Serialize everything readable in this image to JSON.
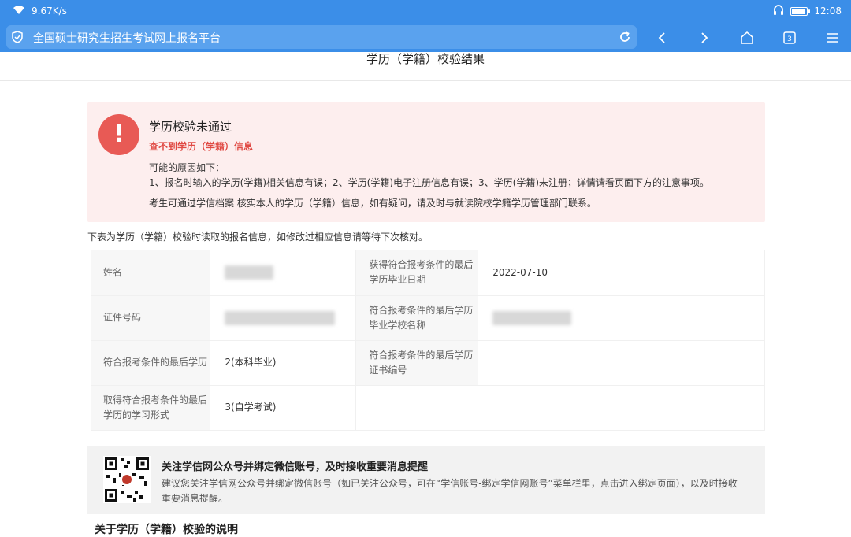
{
  "status_bar": {
    "speed": "9.67K/s",
    "time": "12:08",
    "battery_level": 0.85,
    "icons": [
      "wifi-icon",
      "headphones-icon",
      "battery-icon"
    ]
  },
  "browser": {
    "title": "全国硕士研究生招生考试网上报名平台",
    "tab_count": "3",
    "icons": [
      "shield-check-icon",
      "reload-icon",
      "back-icon",
      "forward-icon",
      "home-icon",
      "tabs-icon",
      "menu-icon"
    ]
  },
  "page": {
    "title": "学历（学籍）校验结果"
  },
  "error": {
    "title": "学历校验未通过",
    "subtitle": "查不到学历（学籍）信息",
    "reason_intro": "可能的原因如下：",
    "reason_detail": "1、报名时输入的学历(学籍)相关信息有误；2、学历(学籍)电子注册信息有误；3、学历(学籍)未注册；详情请看页面下方的注意事项。",
    "note": "考生可通过学信档案 核实本人的学历（学籍）信息，如有疑问，请及时与就读院校学籍学历管理部门联系。",
    "icon_glyph": "!"
  },
  "intro": "下表为学历（学籍）校验时读取的报名信息，如修改过相应信息请等待下次核对。",
  "table": {
    "rows": [
      {
        "label1": "姓名",
        "value1": "",
        "label2": "获得符合报考条件的最后学历毕业日期",
        "value2": "2022-07-10"
      },
      {
        "label1": "证件号码",
        "value1": "",
        "label2": "符合报考条件的最后学历毕业学校名称",
        "value2": ""
      },
      {
        "label1": "符合报考条件的最后学历",
        "value1": "2(本科毕业)",
        "label2": "符合报考条件的最后学历证书编号",
        "value2": ""
      },
      {
        "label1": "取得符合报考条件的最后学历的学习形式",
        "value1": "3(自学考试)",
        "label2": "",
        "value2": ""
      }
    ]
  },
  "promo": {
    "title": "关注学信网公众号并绑定微信账号，及时接收重要消息提醒",
    "text": "建议您关注学信网公众号并绑定微信账号（如已关注公众号，可在“学信账号-绑定学信网账号”菜单栏里，点击进入绑定页面），以及时接收重要消息提醒。"
  },
  "section_title": "关于学历（学籍）校验的说明",
  "colors": {
    "brand_blue": "#3b8ee8",
    "error_red": "#e85a55",
    "error_bg": "#fdeeee"
  }
}
